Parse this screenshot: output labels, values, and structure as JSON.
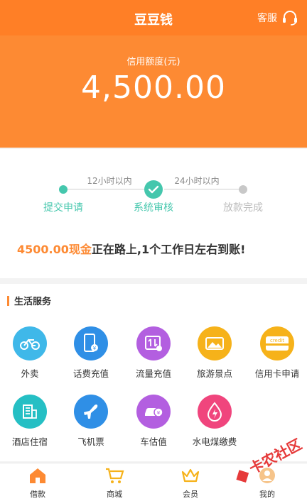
{
  "header": {
    "title": "豆豆钱",
    "service_label": "客服",
    "service_icon": "headset-icon",
    "credit_label": "信用额度(元)",
    "credit_amount": "4,500.00",
    "accent_color": "#fd8a33"
  },
  "progress": {
    "times": [
      "12小时以内",
      "24小时以内"
    ],
    "steps": [
      {
        "label": "提交申请",
        "state": "done",
        "color": "#45c7ad"
      },
      {
        "label": "系统审核",
        "state": "current",
        "color": "#45c7ad"
      },
      {
        "label": "放款完成",
        "state": "pending",
        "color": "#c8c8c8"
      }
    ],
    "notice_highlight": "4500.00现金",
    "notice_rest": "正在路上,1个工作日左右到账!"
  },
  "services": {
    "title": "生活服务",
    "items": [
      {
        "label": "外卖",
        "icon": "bicycle-icon",
        "color": "#3fb8e9"
      },
      {
        "label": "话费充值",
        "icon": "phone-recharge-icon",
        "color": "#2f8fe6"
      },
      {
        "label": "流量充值",
        "icon": "data-recharge-icon",
        "color": "#b35fe0"
      },
      {
        "label": "旅游景点",
        "icon": "scenery-icon",
        "color": "#f6b21a"
      },
      {
        "label": "信用卡申请",
        "icon": "credit-card-icon",
        "color": "#f6b21a"
      },
      {
        "label": "酒店住宿",
        "icon": "hotel-icon",
        "color": "#25bfc4"
      },
      {
        "label": "飞机票",
        "icon": "airplane-icon",
        "color": "#2f8fe6"
      },
      {
        "label": "车估值",
        "icon": "car-valuation-icon",
        "color": "#b35fe0"
      },
      {
        "label": "水电煤缴费",
        "icon": "utility-icon",
        "color": "#f0457d"
      }
    ],
    "credit_card_text": "credit"
  },
  "nav": {
    "items": [
      {
        "label": "借款",
        "icon": "home-icon",
        "active": true
      },
      {
        "label": "商城",
        "icon": "cart-icon",
        "active": false
      },
      {
        "label": "会员",
        "icon": "crown-icon",
        "active": false
      },
      {
        "label": "我的",
        "icon": "profile-icon",
        "active": false
      }
    ]
  },
  "watermark": {
    "text": "卡农社区"
  }
}
